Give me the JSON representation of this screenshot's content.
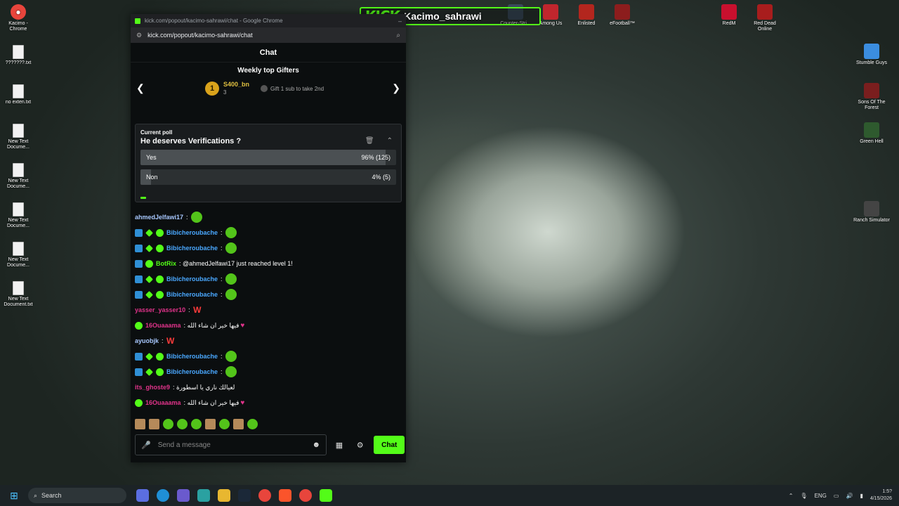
{
  "desktop_left_icons": [
    {
      "label": "Kacimo - Chrome",
      "icon": "chrome-icon"
    },
    {
      "label": "???????.txt",
      "icon": "text-file-icon"
    },
    {
      "label": "no exten.txt",
      "icon": "text-file-icon"
    },
    {
      "label": "New Text Docume...",
      "icon": "text-file-icon"
    },
    {
      "label": "New Text Docume...",
      "icon": "text-file-icon"
    },
    {
      "label": "New Text Docume...",
      "icon": "text-file-icon"
    },
    {
      "label": "New Text Docume...",
      "icon": "text-file-icon"
    },
    {
      "label": "New Text Document.txt",
      "icon": "text-file-icon"
    }
  ],
  "desktop_top_icons": [
    {
      "label": "Counter-Stri...",
      "icon": "game-icon"
    },
    {
      "label": "Among Us",
      "icon": "game-icon"
    },
    {
      "label": "Enlisted",
      "icon": "game-icon"
    },
    {
      "label": "eFootball™",
      "icon": "game-icon"
    },
    {
      "label": "RedM",
      "icon": "game-icon"
    },
    {
      "label": "Red Dead Online",
      "icon": "game-icon"
    }
  ],
  "desktop_right_icons": [
    {
      "label": "Stumble Guys",
      "icon": "game-icon"
    },
    {
      "label": "Sons Of The Forest",
      "icon": "game-icon"
    },
    {
      "label": "Green Hell",
      "icon": "game-icon"
    },
    {
      "label": "Ranch Simulator",
      "icon": "game-icon"
    }
  ],
  "overlay": {
    "brand": "KICK",
    "channel": "Kacimo_sahrawi"
  },
  "window": {
    "title": "kick.com/popout/kacimo-sahrawi/chat - Google Chrome",
    "url": "kick.com/popout/kacimo-sahrawi/chat"
  },
  "chat": {
    "header": "Chat",
    "gifters_title": "Weekly top Gifters",
    "top_gifter": {
      "rank": "1",
      "name": "S400_bn",
      "count": "3"
    },
    "gift_hint": "Gift 1 sub to take 2nd"
  },
  "poll": {
    "label": "Current poll",
    "question": "He deserves Verifications ?",
    "options": [
      {
        "label": "Yes",
        "result": "96% (125)",
        "share": 0.96
      },
      {
        "label": "Non",
        "result": "4% (5)",
        "share": 0.04
      }
    ]
  },
  "messages": [
    {
      "user": "ahmedJelfawi17",
      "color": "#a8c8ff",
      "badges": [],
      "text": "",
      "emote": "green"
    },
    {
      "user": "Bibicheroubache",
      "color": "#4aa8ff",
      "badges": [
        "blue",
        "star",
        "green"
      ],
      "text": "",
      "emote": "green"
    },
    {
      "user": "Bibicheroubache",
      "color": "#4aa8ff",
      "badges": [
        "blue",
        "star",
        "green"
      ],
      "text": "",
      "emote": "green"
    },
    {
      "user": "BotRix",
      "color": "#53fc18",
      "badges": [
        "blue",
        "green"
      ],
      "text": "@ahmedJelfawi17 just reached level 1!",
      "emote": ""
    },
    {
      "user": "Bibicheroubache",
      "color": "#4aa8ff",
      "badges": [
        "blue",
        "star",
        "green"
      ],
      "text": "",
      "emote": "green"
    },
    {
      "user": "Bibicheroubache",
      "color": "#4aa8ff",
      "badges": [
        "blue",
        "star",
        "green"
      ],
      "text": "",
      "emote": "green"
    },
    {
      "user": "yasser_yasser10",
      "color": "#e0338a",
      "badges": [],
      "text": "",
      "emote": "w"
    },
    {
      "user": "16Ouaaama",
      "color": "#e0338a",
      "badges": [
        "green"
      ],
      "text": "فيها خير ان شاء الله",
      "emote": "heart"
    },
    {
      "user": "ayuobjk",
      "color": "#a8c8ff",
      "badges": [],
      "text": "",
      "emote": "w"
    },
    {
      "user": "Bibicheroubache",
      "color": "#4aa8ff",
      "badges": [
        "blue",
        "star",
        "green"
      ],
      "text": "",
      "emote": "green"
    },
    {
      "user": "Bibicheroubache",
      "color": "#4aa8ff",
      "badges": [
        "blue",
        "star",
        "green"
      ],
      "text": "",
      "emote": "green"
    },
    {
      "user": "its_ghoste9",
      "color": "#e0338a",
      "badges": [],
      "text": "لعيالك ناري يا اسطورة",
      "emote": ""
    },
    {
      "user": "16Ouaaama",
      "color": "#e0338a",
      "badges": [
        "green"
      ],
      "text": "فيها خير ان شاء الله",
      "emote": "heart"
    }
  ],
  "input": {
    "placeholder": "Send a message",
    "send_label": "Chat"
  },
  "taskbar": {
    "search_label": "Search",
    "language": "ENG",
    "time": "1:5?",
    "date": "4/15/2026"
  },
  "colors": {
    "kick_green": "#53fc18",
    "bg_dark": "#0b0e0f"
  }
}
